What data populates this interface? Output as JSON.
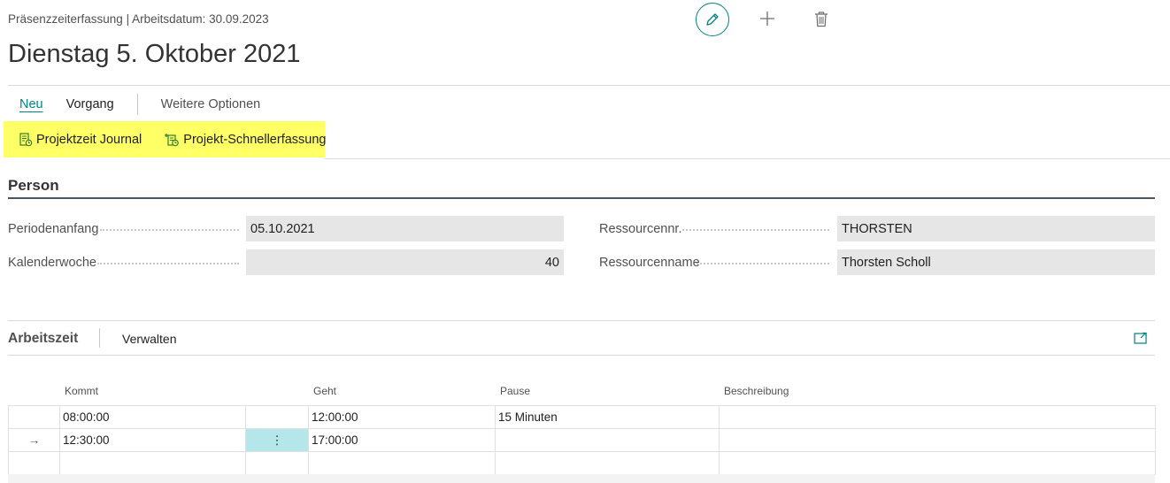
{
  "header": {
    "breadcrumb": "Präsenzzeiterfassung | Arbeitsdatum: 30.09.2023",
    "title": "Dienstag 5. Oktober 2021"
  },
  "toolbar_icons": {
    "edit": "pencil-icon",
    "new": "plus-icon",
    "delete": "trash-icon"
  },
  "actions": {
    "tabs": [
      "Neu",
      "Vorgang"
    ],
    "more": "Weitere Optionen",
    "promoted": [
      {
        "label": "Projektzeit Journal",
        "icon": "journal-icon"
      },
      {
        "label": "Projekt-Schnellerfassung",
        "icon": "quick-entry-icon"
      }
    ]
  },
  "person": {
    "title": "Person",
    "fields": [
      {
        "label": "Periodenanfang",
        "value": "05.10.2021"
      },
      {
        "label": "Kalenderwoche",
        "value": "40"
      },
      {
        "label": "Ressourcennr.",
        "value": "THORSTEN"
      },
      {
        "label": "Ressourcenname",
        "value": "Thorsten Scholl"
      }
    ]
  },
  "arbeitszeit": {
    "title": "Arbeitszeit",
    "action": "Verwalten",
    "columns": [
      "Kommt",
      "Geht",
      "Pause",
      "Beschreibung"
    ],
    "rows": [
      {
        "indicator": "",
        "kommt": "08:00:00",
        "menu": "",
        "geht": "12:00:00",
        "pause": "15 Minuten",
        "beschreibung": ""
      },
      {
        "indicator": "→",
        "kommt": "12:30:00",
        "menu": "⋮",
        "geht": "17:00:00",
        "pause": "",
        "beschreibung": ""
      },
      {
        "indicator": "",
        "kommt": "",
        "menu": "",
        "geht": "",
        "pause": "",
        "beschreibung": ""
      }
    ]
  },
  "colors": {
    "accent": "#00827f",
    "highlight": "#ffff66",
    "field_bg": "#e6e6e6",
    "selected_cell": "#b4e6ea"
  }
}
